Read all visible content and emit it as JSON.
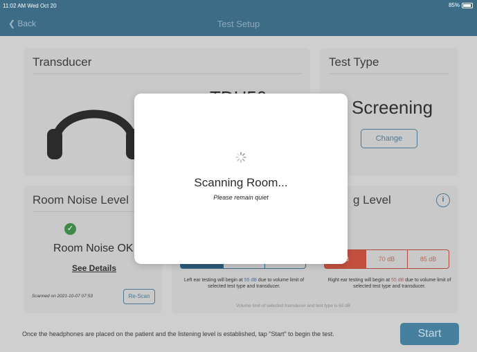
{
  "status": {
    "time": "11:02 AM  Wed Oct 20",
    "battery": "85%"
  },
  "nav": {
    "back_label": "Back",
    "title": "Test Setup"
  },
  "transducer": {
    "title": "Transducer",
    "model": "TDH50",
    "icon": "headphones-icon"
  },
  "test_type": {
    "title": "Test Type",
    "value": "Screening",
    "change_label": "Change"
  },
  "room_noise": {
    "title": "Room Noise Level",
    "status": "Room Noise OK",
    "details_label": "See Details",
    "scanned_text": "Scanned on 2021-10-07 07:53",
    "rescan_label": "Re-Scan"
  },
  "listening_level": {
    "title_visible": "g Level",
    "warning_visible": "t",
    "right_options": [
      "dB",
      "70 dB",
      "85 dB"
    ],
    "left_note": {
      "pre": "Left ear testing will begin at ",
      "level": "55 dB",
      "post": " due to volume limit of selected test type and transducer."
    },
    "right_note": {
      "pre": "Right ear testing will begin at ",
      "level": "55 dB",
      "post": " due to volume limit of selected test type and transducer."
    },
    "volume_limit": "Volume limit of selected transducer and test type is 60 dB"
  },
  "footer": {
    "instructions": "Once the headphones are placed on the patient and the listening level is established, tap \"Start\" to begin the test.",
    "start_label": "Start"
  },
  "modal": {
    "title": "Scanning Room...",
    "subtitle": "Please remain quiet"
  },
  "colors": {
    "nav": "#3d6c86",
    "accent": "#4b7893",
    "warning": "#b14a3c",
    "ok": "#3f8a4a"
  }
}
